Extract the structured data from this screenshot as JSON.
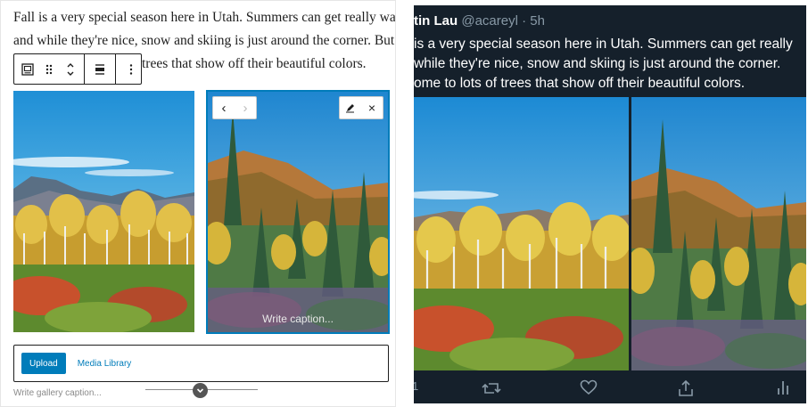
{
  "editor": {
    "paragraph_lines": [
      "Fall is a very special season here in Utah. Summers can get really warm",
      "and while they're nice, snow and skiing is just around the corner. But",
      "trees that show off their beautiful colors."
    ],
    "image_caption_placeholder": "Write caption...",
    "upload_label": "Upload",
    "media_library_label": "Media Library",
    "gallery_caption_placeholder": "Write gallery caption...",
    "accent_color": "#007cba"
  },
  "tweet": {
    "name": "tin Lau",
    "handle": "@acareyl",
    "time_sep": "·",
    "time": "5h",
    "lines": [
      "is a very special season here in Utah. Summers can get really",
      "while they're nice, snow and skiing is just around the corner.",
      "ome to lots of trees that show off their beautiful colors."
    ],
    "reply_count": "1",
    "background": "#15202b",
    "icons": [
      "reply-icon",
      "retweet-icon",
      "like-icon",
      "share-icon",
      "analytics-icon"
    ]
  }
}
